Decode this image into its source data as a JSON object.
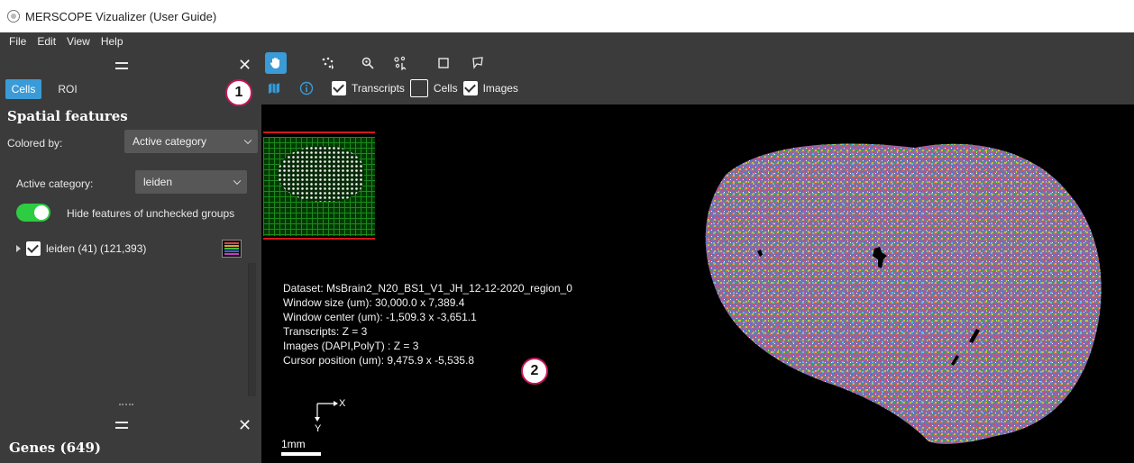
{
  "window": {
    "title": "MERSCOPE Vizualizer (User Guide)"
  },
  "menu": {
    "items": [
      "File",
      "Edit",
      "View",
      "Help"
    ]
  },
  "left_panel": {
    "tabs": [
      {
        "label": "Cells",
        "active": true
      },
      {
        "label": "ROI",
        "active": false
      }
    ],
    "spatial_title": "Spatial features",
    "colored_by_label": "Colored by:",
    "colored_by_value": "Active category",
    "active_category_label": "Active category:",
    "active_category_value": "leiden",
    "hide_toggle_label": "Hide features of unchecked groups",
    "hide_toggle_on": true,
    "tree_item_label": "leiden (41) (121,393)",
    "tree_item_checked": true,
    "genes_title": "Genes (649)"
  },
  "toolbar": {
    "tools": [
      "pan-hand-icon",
      "scatter-points-icon",
      "zoom-icon",
      "select-points-icon",
      "rectangle-select-icon",
      "lasso-select-icon"
    ],
    "active_tool": "pan-hand-icon",
    "view_toggles": [
      {
        "label": "Transcripts",
        "checked": true
      },
      {
        "label": "Cells",
        "checked": false
      },
      {
        "label": "Images",
        "checked": true
      }
    ]
  },
  "info": {
    "dataset": "Dataset: MsBrain2_N20_BS1_V1_JH_12-12-2020_region_0",
    "window_size": "Window size (um): 30,000.0 x 7,389.4",
    "window_center": "Window center (um): -1,509.3 x -3,651.1",
    "transcripts": "Transcripts: Z = 3",
    "images": "Images (DAPI,PolyT) : Z = 3",
    "cursor": "Cursor position (um): 9,475.9 x -5,535.8"
  },
  "axes": {
    "x": "X",
    "y": "Y"
  },
  "scalebar": {
    "label": "1mm"
  },
  "callouts": {
    "one": "1",
    "two": "2"
  },
  "colors": {
    "panel_bg": "#3b3b3b",
    "canvas_bg": "#000000",
    "accent": "#3a9bd6",
    "toggle_on": "#2ecc40",
    "callout_border": "#c2185b"
  }
}
